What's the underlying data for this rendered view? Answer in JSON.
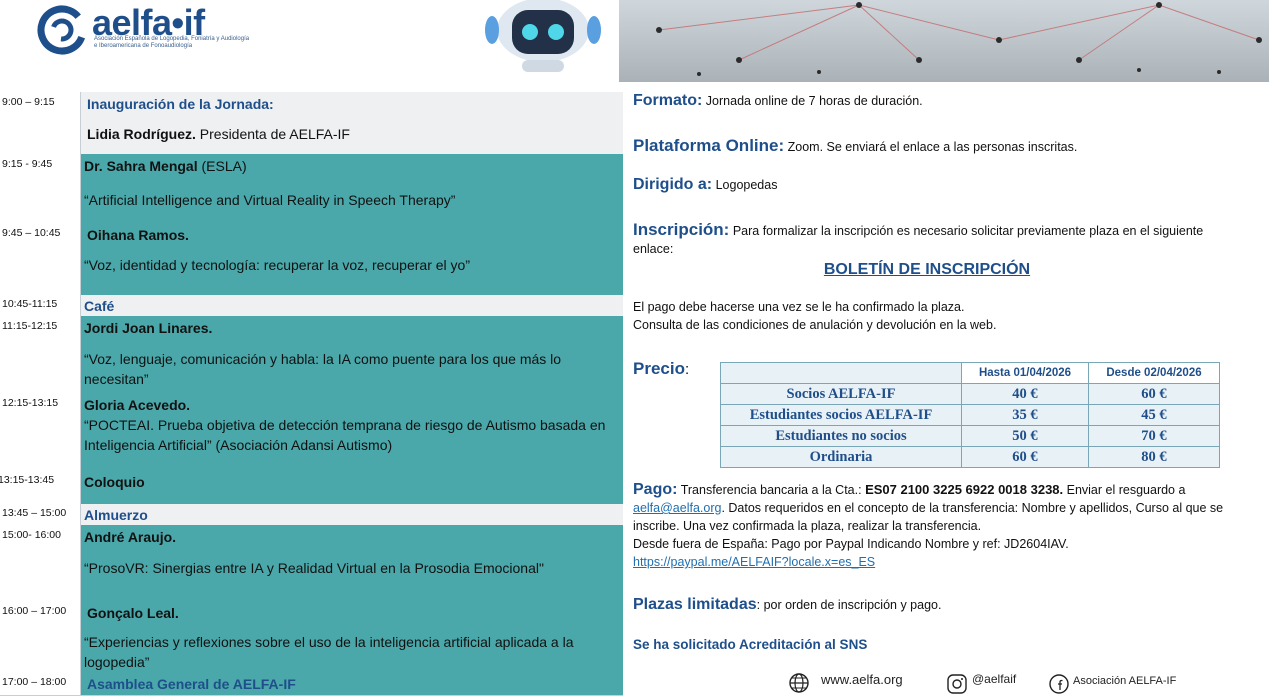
{
  "header": {
    "logo_word": "aelfa•if",
    "logo_subtitle": "Asociación Española de Logopedia, Foniatría y Audiología e Iberoamericana de Fonoaudiología"
  },
  "schedule": [
    {
      "time": "9:00 – 9:15",
      "title": "Inauguración de la Jornada:",
      "speaker_name": "Lidia Rodríguez.",
      "speaker_role": " Presidenta de AELFA-IF"
    },
    {
      "time": "9:15 - 9:45",
      "speaker_name": "Dr. Sahra Mengal",
      "speaker_affil": " (ESLA)",
      "talk": "“Artificial Intelligence and Virtual Reality in Speech Therapy”"
    },
    {
      "time": "9:45 – 10:45",
      "speaker_name": "Oihana Ramos.",
      "talk": "“Voz, identidad y tecnología: recuperar la voz, recuperar el yo”"
    },
    {
      "time": "10:45-11:15",
      "title": "Café"
    },
    {
      "time": "11:15-12:15",
      "speaker_name": "Jordi Joan Linares.",
      "talk": "“Voz, lenguaje, comunicación y habla: la IA como puente para los que más lo necesitan”"
    },
    {
      "time": "12:15-13:15",
      "speaker_name": "Gloria Acevedo.",
      "talk": " “POCTEAI. Prueba objetiva de detección temprana de riesgo de Autismo basada en Inteligencia Artificial” (Asociación Adansi Autismo)"
    },
    {
      "time": "13:15-13:45",
      "title": "Coloquio"
    },
    {
      "time": "13:45 – 15:00",
      "title": "Almuerzo"
    },
    {
      "time": "15:00- 16:00",
      "speaker_name": "André Araujo.",
      "talk": "“ProsoVR: Sinergias entre IA y Realidad Virtual en la Prosodia Emocional\""
    },
    {
      "time": "16:00 – 17:00",
      "speaker_name": "Gonçalo Leal.",
      "talk": "“Experiencias y reflexiones sobre el uso de la inteligencia artificial aplicada a la logopedia”"
    },
    {
      "time": "17:00 – 18:00",
      "title": "Asamblea General de AELFA-IF"
    }
  ],
  "info": {
    "formato_label": "Formato:",
    "formato_text": " Jornada online de 7 horas de duración.",
    "plataforma_label": "Plataforma Online:",
    "plataforma_text": "  Zoom. Se enviará el enlace a las personas inscritas.",
    "dirigido_label": "Dirigido a:",
    "dirigido_text": " Logopedas",
    "inscripcion_label": "Inscripción:",
    "inscripcion_text": " Para formalizar la inscripción es necesario solicitar previamente plaza en el siguiente enlace:",
    "boletin_link": "BOLETÍN DE INSCRIPCIÓN",
    "pago_note_1": "El pago debe hacerse una vez se le ha confirmado la plaza.",
    "pago_note_2": "Consulta de las condiciones de anulación y devolución en la web.",
    "precio_label": "Precio",
    "precio_colon": ":",
    "pago_label": "Pago:",
    "pago_text_1": " Transferencia bancaria a la Cta.: ",
    "pago_account": "ES07 2100 3225 6922 0018 3238.",
    "pago_text_2": " Enviar el resguardo a ",
    "pago_email": "aelfa@aelfa.org",
    "pago_text_3": ". Datos requeridos en el concepto de la transferencia: Nombre y apellidos, Curso al que se inscribe. Una vez confirmada la plaza, realizar la transferencia.",
    "pago_text_4": "Desde fuera de España: Pago por Paypal Indicando Nombre y ref: JD2604IAV.",
    "paypal_link": "https://paypal.me/AELFAIF?locale.x=es_ES",
    "plazas_label": "Plazas limitadas",
    "plazas_text": ": por orden de inscripción y pago.",
    "acreditacion": "Se ha solicitado Acreditación al SNS"
  },
  "prices": {
    "headers": [
      "Hasta 01/04/2026",
      "Desde 02/04/2026"
    ],
    "rows": [
      {
        "label": "Socios AELFA-IF",
        "early": "40 €",
        "late": "60 €"
      },
      {
        "label": "Estudiantes socios AELFA-IF",
        "early": "35 €",
        "late": "45 €"
      },
      {
        "label": "Estudiantes no socios",
        "early": "50 €",
        "late": "70 €"
      },
      {
        "label": "Ordinaria",
        "early": "60 €",
        "late": "80 €"
      }
    ]
  },
  "footer": {
    "web": "www.aelfa.org",
    "instagram": "@aelfaif",
    "facebook": "Asociación AELFA-IF"
  }
}
